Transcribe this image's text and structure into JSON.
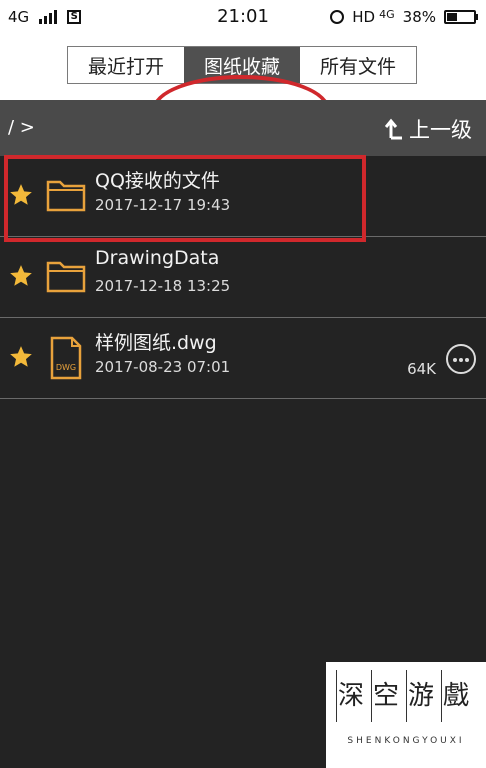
{
  "status_bar": {
    "network": "4G",
    "time": "21:01",
    "hd": "HD",
    "network2": "4G",
    "battery_percent": "38%",
    "battery_level": 0.38
  },
  "tabs": [
    {
      "label": "最近打开",
      "active": false
    },
    {
      "label": "图纸收藏",
      "active": true
    },
    {
      "label": "所有文件",
      "active": false
    }
  ],
  "path_bar": {
    "path": "/ >",
    "up_label": "上一级"
  },
  "files": [
    {
      "name": "QQ接收的文件",
      "date": "2017-12-17 19:43",
      "type": "folder",
      "size": ""
    },
    {
      "name": "DrawingData",
      "date": "2017-12-18 13:25",
      "type": "folder",
      "size": ""
    },
    {
      "name": "样例图纸.dwg",
      "date": "2017-08-23 07:01",
      "type": "dwg",
      "size": "64K",
      "dwg_label": "DWG"
    }
  ],
  "watermark": {
    "chars": [
      "深",
      "空",
      "游",
      "戲"
    ],
    "latin": "SHENKONGYOUXI"
  },
  "colors": {
    "accent": "#e8a23c",
    "annotation_red": "#d0282c",
    "background": "#232323",
    "tab_active": "#505050"
  }
}
